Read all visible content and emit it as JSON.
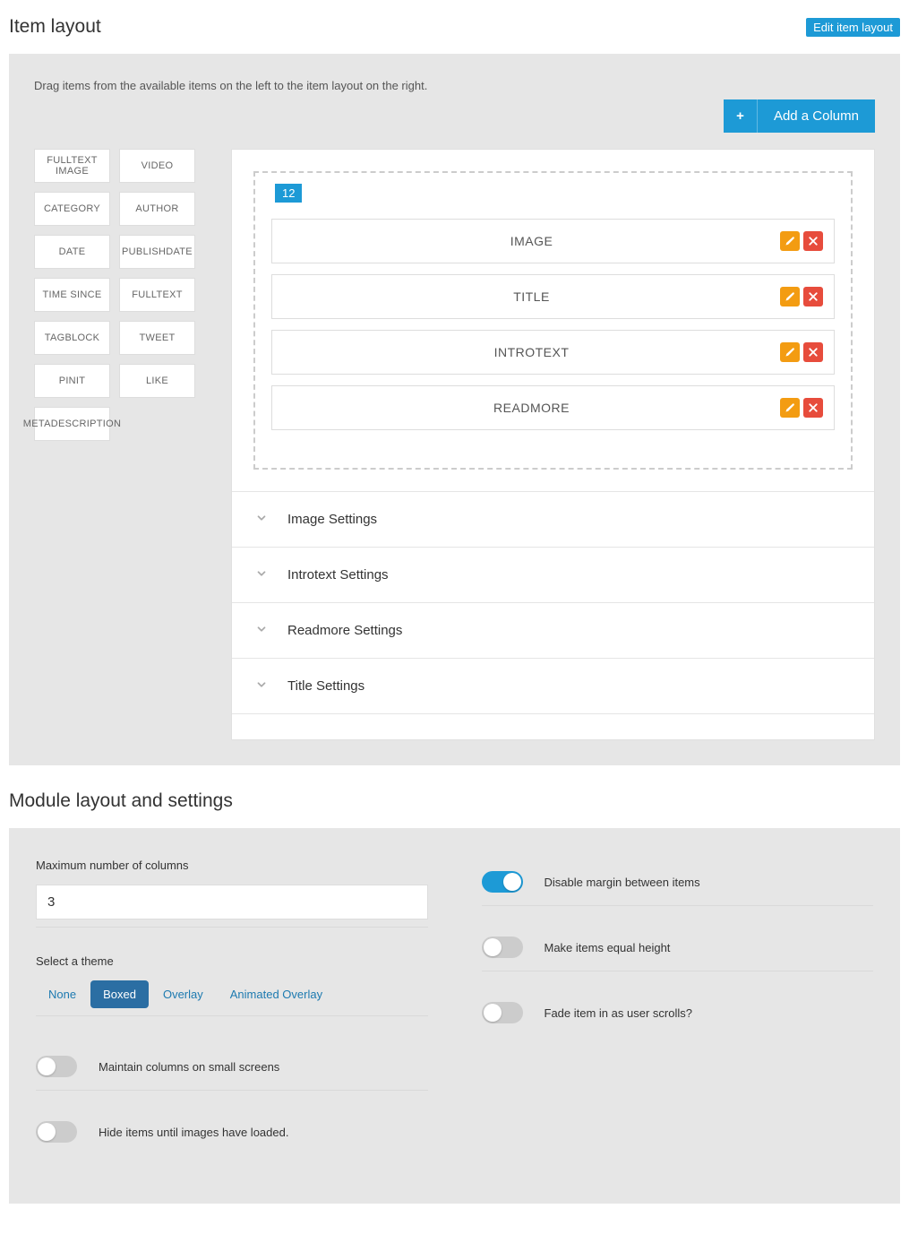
{
  "section1": {
    "title": "Item layout",
    "edit_label": "Edit item layout",
    "instruction": "Drag items from the available items on the left to the item layout on the right.",
    "add_column_label": "Add a Column"
  },
  "available_items": [
    "FULLTEXT IMAGE",
    "VIDEO",
    "CATEGORY",
    "AUTHOR",
    "DATE",
    "PUBLISHDATE",
    "TIME SINCE",
    "FULLTEXT",
    "TAGBLOCK",
    "TWEET",
    "PINIT",
    "LIKE",
    "METADESCRIPTION"
  ],
  "column": {
    "width": "12",
    "items": [
      "IMAGE",
      "TITLE",
      "INTROTEXT",
      "READMORE"
    ]
  },
  "accordion": [
    "Image Settings",
    "Introtext Settings",
    "Readmore Settings",
    "Title Settings"
  ],
  "section2": {
    "title": "Module layout and settings"
  },
  "fields": {
    "max_cols_label": "Maximum number of columns",
    "max_cols_value": "3",
    "theme_label": "Select a theme",
    "theme_options": [
      "None",
      "Boxed",
      "Overlay",
      "Animated Overlay"
    ],
    "theme_selected": "Boxed",
    "maintain_cols_label": "Maintain columns on small screens",
    "hide_items_label": "Hide items until images have loaded.",
    "disable_margin_label": "Disable margin between items",
    "equal_height_label": "Make items equal height",
    "fade_in_label": "Fade item in as user scrolls?"
  },
  "toggles": {
    "maintain_cols": false,
    "hide_items": false,
    "disable_margin": true,
    "equal_height": false,
    "fade_in": false
  }
}
